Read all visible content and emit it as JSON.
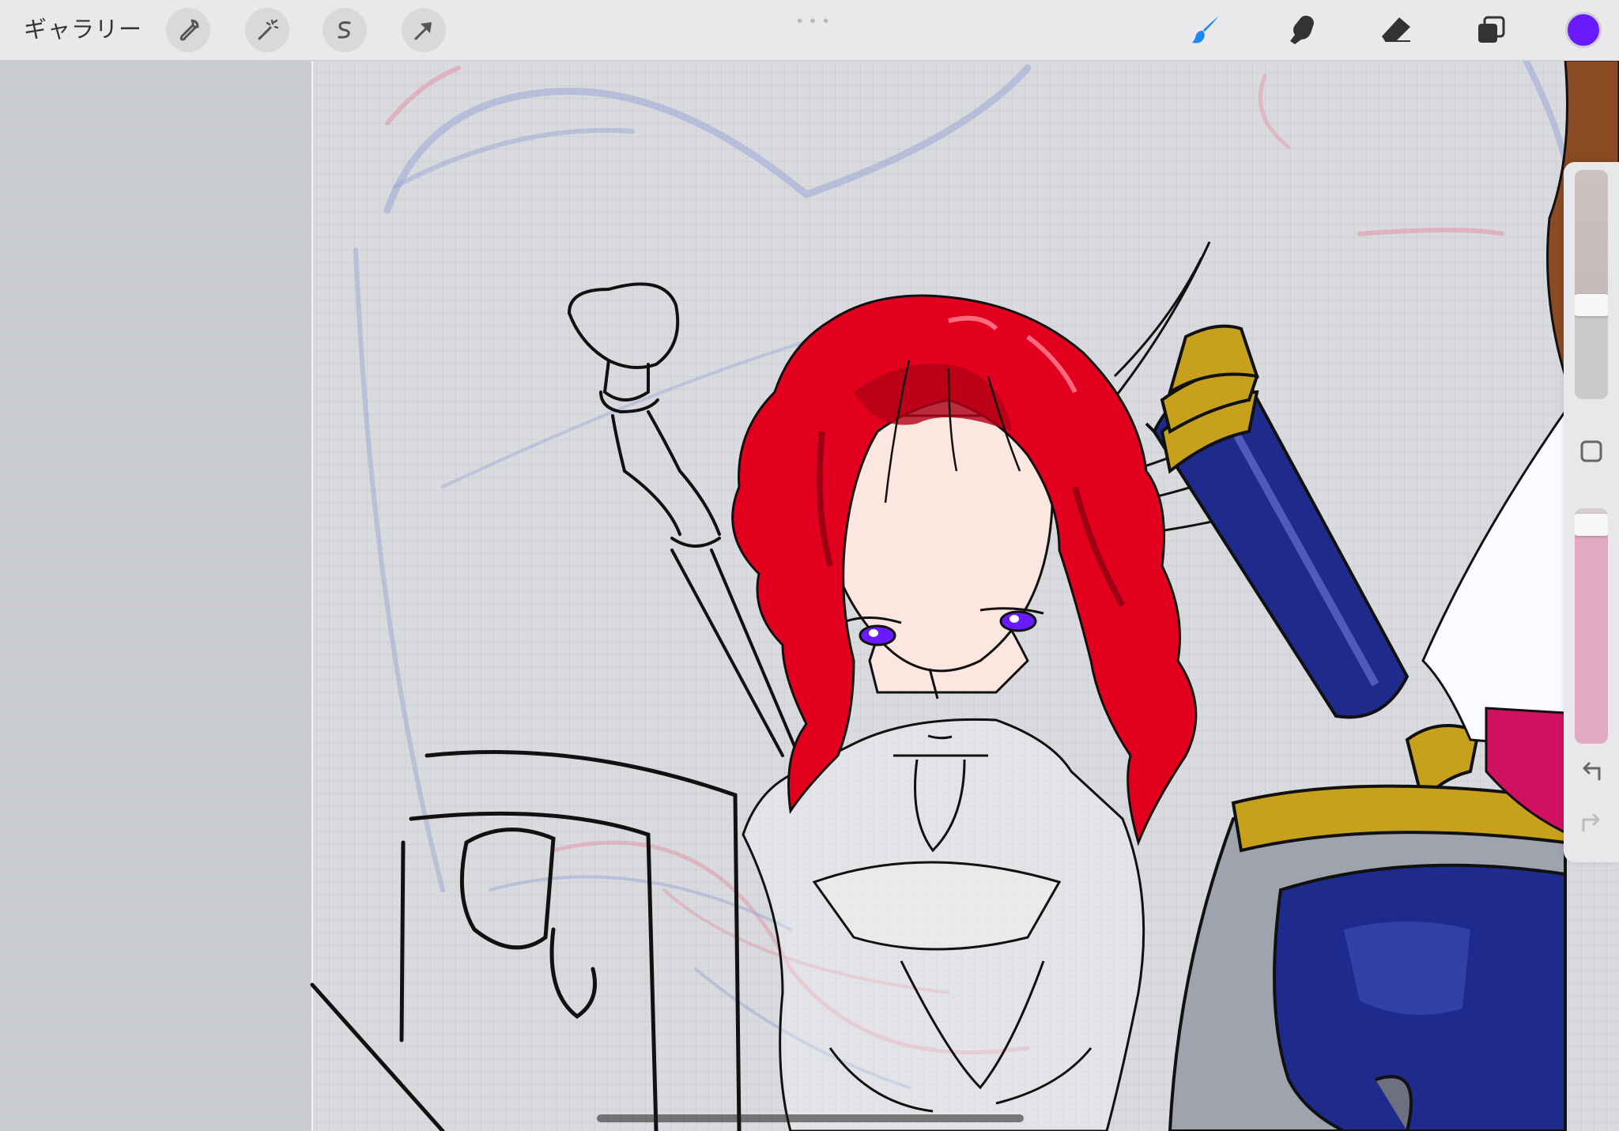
{
  "toolbar": {
    "gallery_label": "ギャラリー",
    "left_tools": [
      {
        "name": "actions",
        "icon": "wrench-icon"
      },
      {
        "name": "adjustments",
        "icon": "magic-wand-icon"
      },
      {
        "name": "selection",
        "icon": "selection-s-icon"
      },
      {
        "name": "transform",
        "icon": "arrow-cursor-icon"
      }
    ],
    "right_tools": [
      {
        "name": "brush",
        "icon": "brush-icon",
        "active": true
      },
      {
        "name": "smudge",
        "icon": "smudge-finger-icon",
        "active": false
      },
      {
        "name": "eraser",
        "icon": "eraser-icon",
        "active": false
      },
      {
        "name": "layers",
        "icon": "layers-icon",
        "active": false
      }
    ],
    "current_color": "#6a1bfd",
    "active_tool_color": "#1e87f0"
  },
  "sidebar": {
    "brush_size": 0.41,
    "opacity": 0.93,
    "modify_button": "square-icon",
    "undo": "undo-icon",
    "redo": "redo-icon",
    "redo_enabled": false
  },
  "colors": {
    "hair": "#e2001e",
    "eyes": "#6a1bfd",
    "shield_blue": "#1e2a8c",
    "gold": "#c7a11b",
    "skin": "#fbe7e0"
  }
}
